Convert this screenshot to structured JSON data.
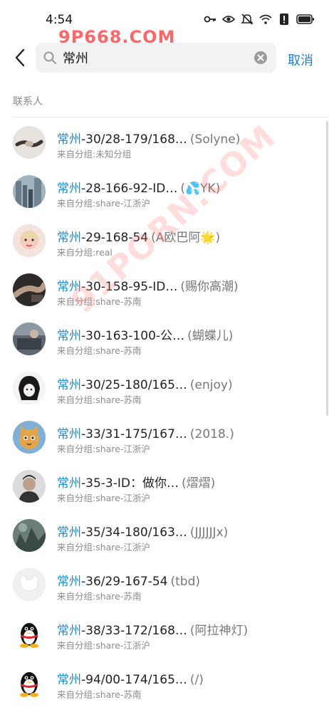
{
  "status_bar": {
    "time": "4:54",
    "icons": [
      "key-icon",
      "eye-icon",
      "mute-icon",
      "wifi-icon",
      "alert-icon",
      "battery-icon"
    ]
  },
  "watermark": {
    "top": "9P668.COM",
    "diagonal": "91PORN.COM"
  },
  "search": {
    "query": "常州",
    "cancel_label": "取消"
  },
  "section": {
    "label": "联系人"
  },
  "contacts": [
    {
      "highlight": "常州",
      "rest": "-30/28-179/168…",
      "nick": "(Solyne)",
      "group": "来自分组:未知分组",
      "avatar": "hands"
    },
    {
      "highlight": "常州",
      "rest": "-28-166-92-ID…",
      "nick": "(💦YK)",
      "group": "来自分组:share-江浙沪",
      "avatar": "city"
    },
    {
      "highlight": "常州",
      "rest": "-29-168-54",
      "nick": "(A欧巴阿🌟)",
      "group": "来自分组:real",
      "avatar": "baby"
    },
    {
      "highlight": "常州",
      "rest": "-30-158-95-ID…",
      "nick": "(赐你高潮)",
      "group": "来自分组:share-苏南",
      "avatar": "hand-dark"
    },
    {
      "highlight": "常州",
      "rest": "-30-163-100-公…",
      "nick": "(蝴蝶儿)",
      "group": "来自分组:share-苏南",
      "avatar": "room"
    },
    {
      "highlight": "常州",
      "rest": "-30/25-180/165…",
      "nick": "(enjoy)",
      "group": "来自分组:share-苏南",
      "avatar": "anime"
    },
    {
      "highlight": "常州",
      "rest": "-33/31-175/167…",
      "nick": "(2018.)",
      "group": "来自分组:share-江浙沪",
      "avatar": "cat"
    },
    {
      "highlight": "常州",
      "rest": "-35-3-ID：做你…",
      "nick": "(熠熠)",
      "group": "来自分组:share-江浙沪",
      "avatar": "man"
    },
    {
      "highlight": "常州",
      "rest": "-35/34-180/163…",
      "nick": "(JJJJJJx)",
      "group": "来自分组:share-江浙沪",
      "avatar": "forest"
    },
    {
      "highlight": "常州",
      "rest": "-36/29-167-54",
      "nick": "(tbd)",
      "group": "来自分组:share-苏南",
      "avatar": "white"
    },
    {
      "highlight": "常州",
      "rest": "-38/33-172/168…",
      "nick": "(阿拉神灯)",
      "group": "来自分组:share-江浙沪",
      "avatar": "penguin"
    },
    {
      "highlight": "常州",
      "rest": "-94/00-174/165…",
      "nick": "(/)",
      "group": "来自分组:share-苏南",
      "avatar": "penguin"
    }
  ]
}
